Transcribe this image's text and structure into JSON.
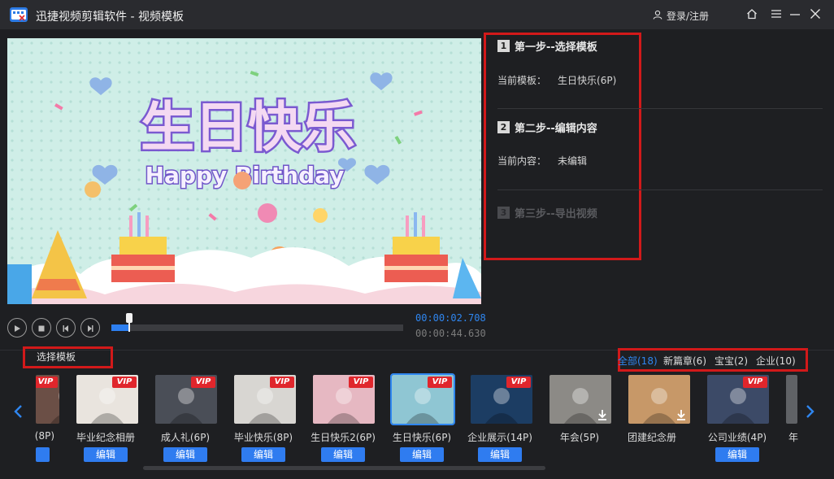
{
  "window": {
    "title": "迅捷视频剪辑软件 - 视频模板",
    "login_label": "登录/注册",
    "icons": [
      "app-logo-icon",
      "user-icon",
      "home-icon",
      "menu-icon",
      "minimize-icon",
      "close-icon"
    ]
  },
  "player": {
    "current_time": "00:00:02.708",
    "total_time": "00:00:44.630",
    "progress": 0.062,
    "preview_text_main": "生日快乐",
    "preview_text_sub": "Happy Birthday"
  },
  "steps": {
    "step1_num": "1",
    "step1_title": "第一步--选择模板",
    "step1_info_label": "当前模板：",
    "step1_info_value": "生日快乐(6P)",
    "step2_num": "2",
    "step2_title": "第二步--编辑内容",
    "step2_info_label": "当前内容：",
    "step2_info_value": "未编辑",
    "step3_num": "3",
    "step3_title": "第三步--导出视频"
  },
  "templates_section": {
    "label": "选择模板",
    "filters": [
      "全部(18)",
      "新篇章(6)",
      "宝宝(2)",
      "企业(10)"
    ],
    "active_filter": "全部(18)",
    "edit_label": "编辑",
    "items": [
      {
        "label": "(8P)",
        "vip": true,
        "edit": false,
        "color": "#6b4f46"
      },
      {
        "label": "毕业纪念相册",
        "vip": true,
        "edit": true,
        "color": "#e9e4de"
      },
      {
        "label": "成人礼(6P)",
        "vip": true,
        "edit": true,
        "color": "#4a4e57"
      },
      {
        "label": "毕业快乐(8P)",
        "vip": true,
        "edit": true,
        "color": "#d8d6d2"
      },
      {
        "label": "生日快乐2(6P)",
        "vip": true,
        "edit": true,
        "color": "#e6b8c2"
      },
      {
        "label": "生日快乐(6P)",
        "vip": true,
        "edit": true,
        "color": "#8fc6d3",
        "selected": true
      },
      {
        "label": "企业展示(14P)",
        "vip": true,
        "edit": true,
        "color": "#1c3d63"
      },
      {
        "label": "年会(5P)",
        "vip": false,
        "edit": false,
        "download": true,
        "color": "#8c8a86"
      },
      {
        "label": "团建纪念册",
        "vip": false,
        "edit": false,
        "download": true,
        "color": "#c79868"
      },
      {
        "label": "公司业绩(4P)",
        "vip": true,
        "edit": true,
        "color": "#3c4a67"
      },
      {
        "label": "年",
        "vip": false,
        "edit": false,
        "color": "#606266"
      }
    ]
  },
  "colors": {
    "accent": "#2f86f0",
    "highlight_box": "#d2191a",
    "background": "#1e1f22"
  }
}
